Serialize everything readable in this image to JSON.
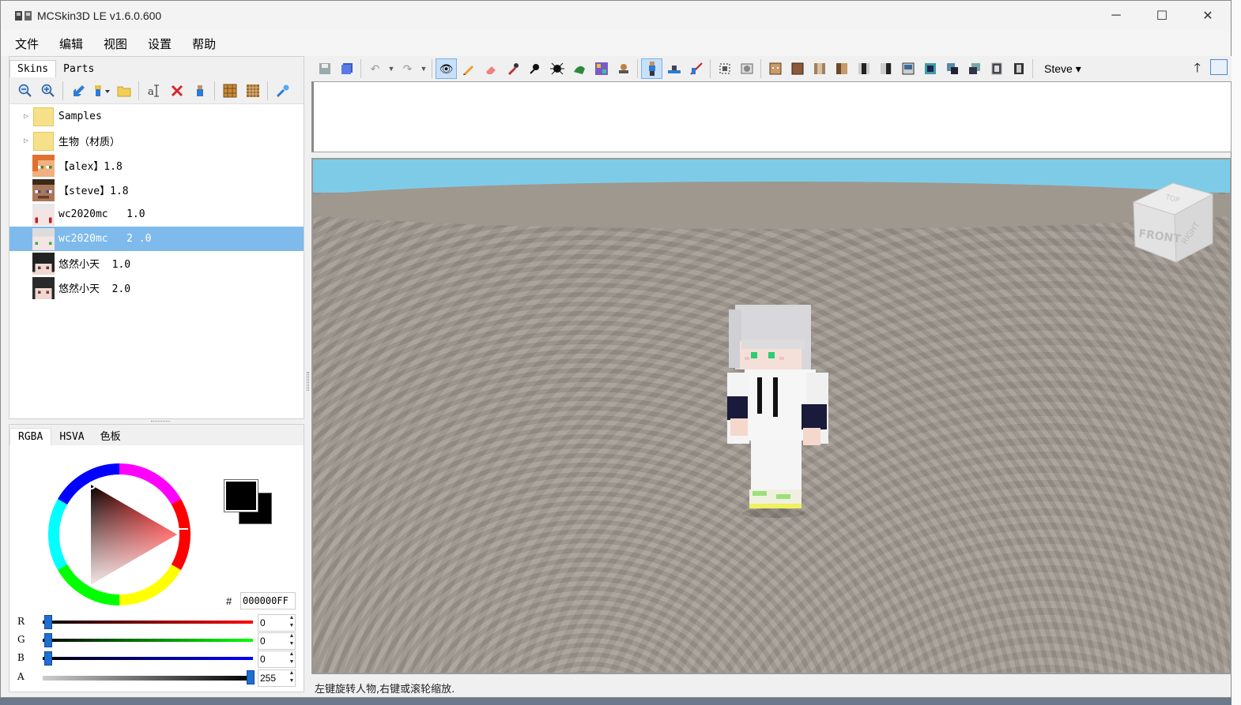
{
  "window": {
    "title": "MCSkin3D LE v1.6.0.600",
    "minimize": "─",
    "maximize": "☐",
    "close": "✕"
  },
  "menu": [
    "文件",
    "编辑",
    "视图",
    "设置",
    "帮助"
  ],
  "left_tabs": {
    "skins": "Skins",
    "parts": "Parts"
  },
  "tree": {
    "folders": [
      "Samples",
      "生物（材质）"
    ],
    "skins": [
      {
        "name": "【alex】1.8",
        "thumb": "alex"
      },
      {
        "name": "【steve】1.8",
        "thumb": "steve"
      },
      {
        "name": "wc2020mc   1.0",
        "thumb": "wc1"
      },
      {
        "name": "wc2020mc   2 .0",
        "thumb": "wc2",
        "selected": true
      },
      {
        "name": "悠然小天  1.0",
        "thumb": "dark1"
      },
      {
        "name": "悠然小天  2.0",
        "thumb": "dark2"
      }
    ]
  },
  "color_tabs": {
    "rgba": "RGBA",
    "hsva": "HSVA",
    "palette": "色板"
  },
  "color": {
    "hash": "#",
    "hex": "000000FF",
    "r_label": "R",
    "r": "0",
    "g_label": "G",
    "g": "0",
    "b_label": "B",
    "b": "0",
    "a_label": "A",
    "a": "255",
    "current": "#000000"
  },
  "toolbar": {
    "model_dropdown": "Steve ▾"
  },
  "navcube": {
    "top": "TOP",
    "front": "FRONT",
    "right": "RIGHT"
  },
  "status": "左键旋转人物,右键或滚轮缩放."
}
